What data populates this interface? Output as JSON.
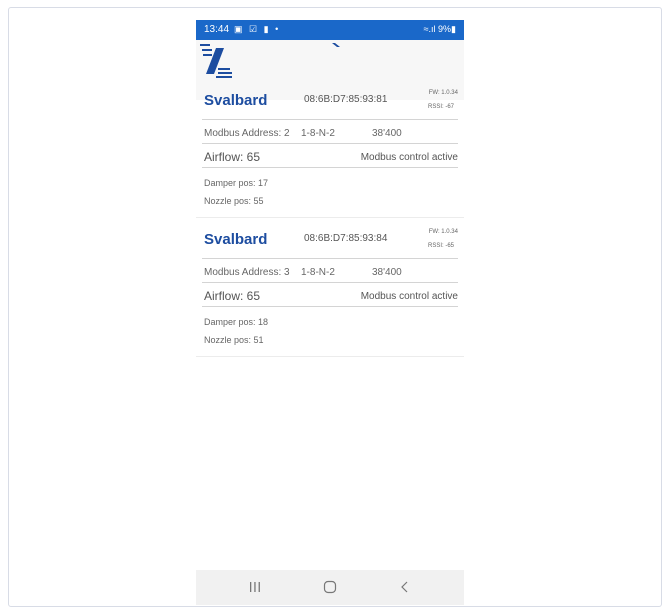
{
  "status_bar": {
    "time": "13:44",
    "notification_icons": [
      "image-icon",
      "check-icon",
      "lock-icon",
      "dot-icon"
    ],
    "right": "≈.ıl 9%▮"
  },
  "colors": {
    "accent": "#1a68c9",
    "title": "#1d4da0"
  },
  "devices": [
    {
      "name": "Svalbard",
      "mac": "08:6B:D7:85:93:81",
      "fw": "FW: 1.0.34",
      "rssi": "RSSI: -67",
      "modbus_address": "Modbus Address: 2",
      "serial": "1-8-N-2",
      "baud": "38'400",
      "airflow": "Airflow: 65",
      "control": "Modbus control active",
      "damper": "Damper pos: 17",
      "nozzle": "Nozzle pos: 55"
    },
    {
      "name": "Svalbard",
      "mac": "08:6B:D7:85:93:84",
      "fw": "FW: 1.0.34",
      "rssi": "RSSI: -65",
      "modbus_address": "Modbus Address: 3",
      "serial": "1-8-N-2",
      "baud": "38'400",
      "airflow": "Airflow: 65",
      "control": "Modbus control active",
      "damper": "Damper pos: 18",
      "nozzle": "Nozzle pos: 51"
    }
  ],
  "nav": {
    "icons": [
      "recent-apps-icon",
      "home-icon",
      "back-icon"
    ]
  }
}
